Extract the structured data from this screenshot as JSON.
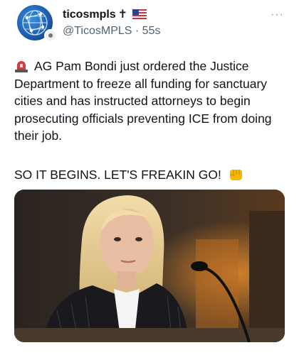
{
  "author": {
    "display_name": "ticosmpls",
    "name_suffix": "✝",
    "handle": "@TicosMPLS",
    "separator": " · ",
    "time_ago": "55s",
    "avatar_icon": "globe-network-icon",
    "flag_icon": "us-flag-icon"
  },
  "menu": {
    "more_label": "···"
  },
  "tweet": {
    "paragraph1": "AG Pam Bondi just ordered the Justice Department to freeze all funding for sanctuary cities and has instructed attorneys to begin prosecuting officials preventing ICE from doing their job.",
    "paragraph2": "SO IT BEGINS. LET'S FREAKIN GO!",
    "lead_icon": "police-siren-icon",
    "trail_icon": "fist-bump-icon"
  },
  "media": {
    "icon": "photo-woman-at-microphone"
  },
  "colors": {
    "text": "#0f1419",
    "secondary": "#536471",
    "siren_red": "#d63a3a",
    "fist_yellow": "#f5b800"
  }
}
